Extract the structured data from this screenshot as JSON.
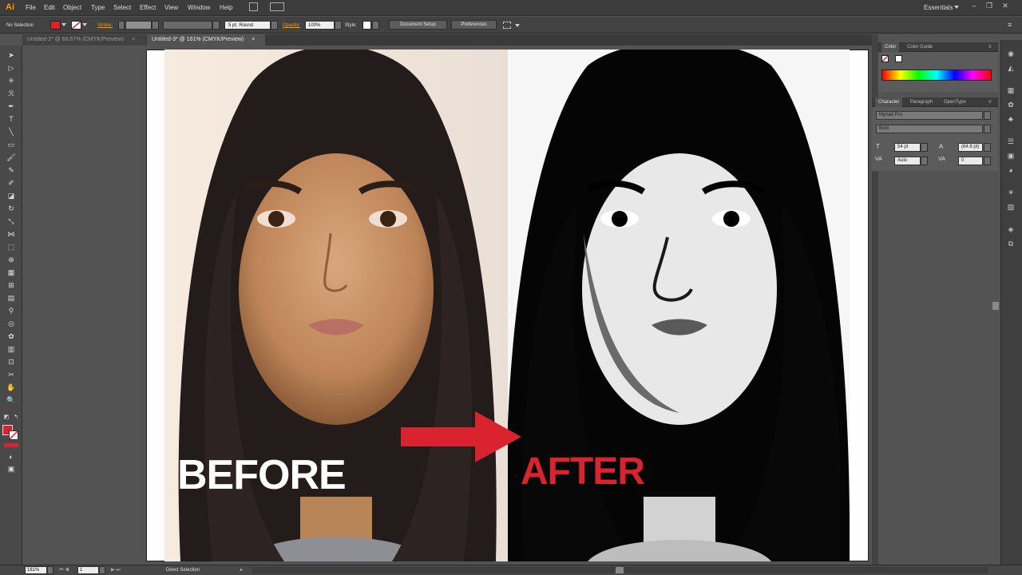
{
  "app": {
    "logo": "Ai"
  },
  "menu": [
    "File",
    "Edit",
    "Object",
    "Type",
    "Select",
    "Effect",
    "View",
    "Window",
    "Help"
  ],
  "workspace": "Essentials",
  "control": {
    "selection": "No Selection",
    "stroke_label": "Stroke:",
    "brush": "5 pt. Round",
    "opacity_label": "Opacity:",
    "opacity_value": "100%",
    "style_label": "Style:",
    "document_setup": "Document Setup",
    "preferences": "Preferences"
  },
  "tabs": [
    {
      "label": "Untitled-2* @ 66.67% (CMYK/Preview)",
      "active": false
    },
    {
      "label": "Untitled-3* @ 161% (CMYK/Preview)",
      "active": true
    }
  ],
  "artwork": {
    "before_text": "BEFORE",
    "after_text": "AFTER",
    "arrow_color": "#d9232e"
  },
  "color_panel": {
    "tab1": "Color",
    "tab2": "Color Guide"
  },
  "character_panel": {
    "tab1": "Character",
    "tab2": "Paragraph",
    "tab3": "OpenType",
    "font": "Myriad Pro",
    "style": "Bold",
    "size": "54 pt",
    "leading": "(64.8 pt)",
    "kerning": "Auto",
    "tracking": "0"
  },
  "status": {
    "zoom": "161%",
    "page": "1",
    "tool": "Direct Selection"
  },
  "colors": {
    "fill": "#d9232e",
    "accent": "#ff9a00"
  }
}
